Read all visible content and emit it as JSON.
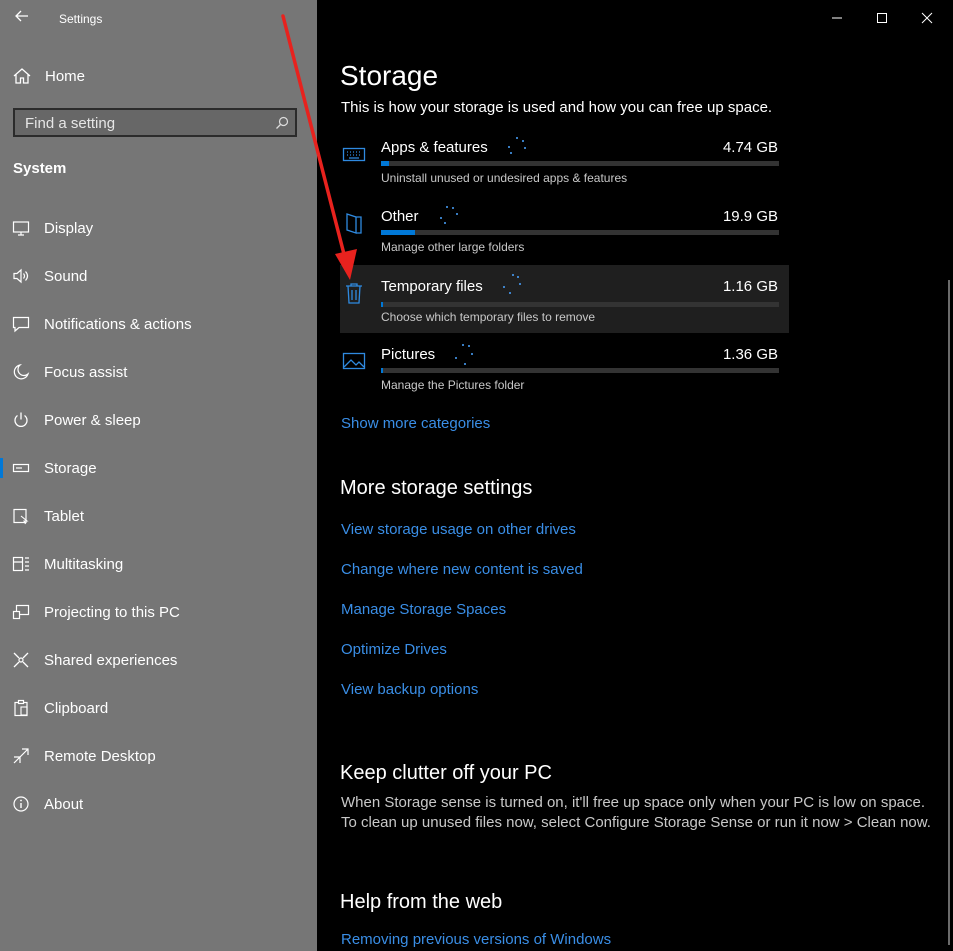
{
  "window": {
    "title": "Settings"
  },
  "sidebar": {
    "home_label": "Home",
    "search_placeholder": "Find a setting",
    "group_title": "System",
    "items": [
      {
        "label": "Display",
        "icon": "monitor-icon"
      },
      {
        "label": "Sound",
        "icon": "speaker-icon"
      },
      {
        "label": "Notifications & actions",
        "icon": "chat-bubble-icon"
      },
      {
        "label": "Focus assist",
        "icon": "moon-icon"
      },
      {
        "label": "Power & sleep",
        "icon": "power-icon"
      },
      {
        "label": "Storage",
        "icon": "drive-icon",
        "active": true
      },
      {
        "label": "Tablet",
        "icon": "tablet-icon"
      },
      {
        "label": "Multitasking",
        "icon": "multitasking-icon"
      },
      {
        "label": "Projecting to this PC",
        "icon": "projector-icon"
      },
      {
        "label": "Shared experiences",
        "icon": "shared-icon"
      },
      {
        "label": "Clipboard",
        "icon": "clipboard-icon"
      },
      {
        "label": "Remote Desktop",
        "icon": "remote-icon"
      },
      {
        "label": "About",
        "icon": "info-icon"
      }
    ]
  },
  "main": {
    "title": "Storage",
    "subtitle": "This is how your storage is used and how you can free up space.",
    "categories": [
      {
        "name": "Apps & features",
        "size": "4.74 GB",
        "desc": "Uninstall unused or undesired apps & features",
        "fill": 0.02,
        "icon": "keyboard-icon"
      },
      {
        "name": "Other",
        "size": "19.9 GB",
        "desc": "Manage other large folders",
        "fill": 0.085,
        "icon": "book-icon"
      },
      {
        "name": "Temporary files",
        "size": "1.16 GB",
        "desc": "Choose which temporary files to remove",
        "fill": 0.005,
        "icon": "trash-icon",
        "highlighted": true
      },
      {
        "name": "Pictures",
        "size": "1.36 GB",
        "desc": "Manage the Pictures folder",
        "fill": 0.005,
        "icon": "picture-icon"
      }
    ],
    "show_more": "Show more categories",
    "more_settings": {
      "title": "More storage settings",
      "links": [
        "View storage usage on other drives",
        "Change where new content is saved",
        "Manage Storage Spaces",
        "Optimize Drives",
        "View backup options"
      ]
    },
    "keep_clutter": {
      "title": "Keep clutter off your PC",
      "line1": "When Storage sense is turned on, it'll free up space only when your PC is low on space.",
      "line2": "To clean up unused files now, select Configure Storage Sense or run it now > Clean now."
    },
    "help": {
      "title": "Help from the web",
      "link": "Removing previous versions of Windows"
    }
  },
  "colors": {
    "accent": "#0078d7",
    "link": "#3a8ee6",
    "annotation_arrow": "#e8221e"
  }
}
